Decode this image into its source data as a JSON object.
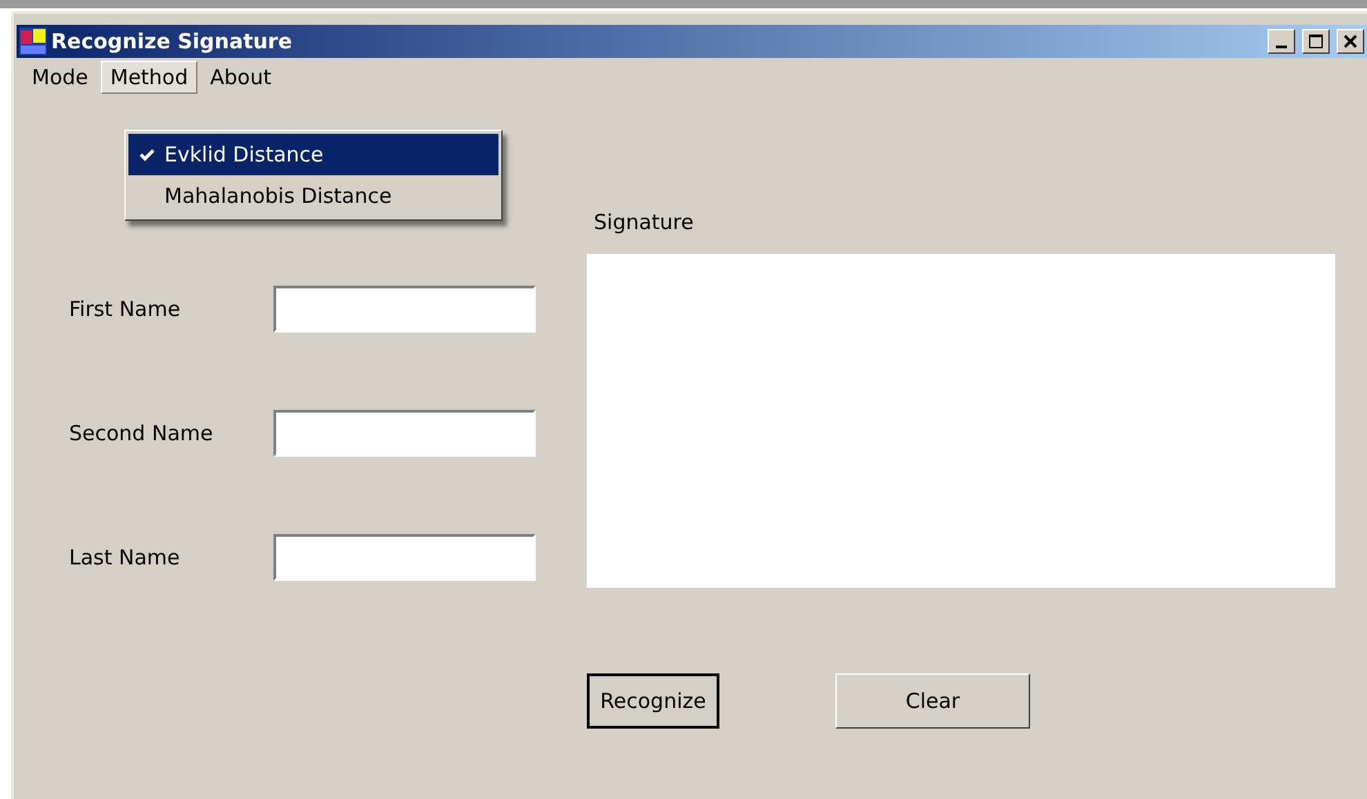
{
  "window": {
    "title": "Recognize Signature"
  },
  "menu": [
    {
      "label": "Mode",
      "selected": false
    },
    {
      "label": "Method",
      "selected": true
    },
    {
      "label": "About",
      "selected": false
    }
  ],
  "dropdown": [
    {
      "label": "Evklid Distance",
      "checked": true,
      "selected": true
    },
    {
      "label": "Mahalanobis Distance",
      "checked": false,
      "selected": false
    }
  ],
  "fields": [
    {
      "label": "First Name"
    },
    {
      "label": "Second Name"
    },
    {
      "label": "Last Name"
    }
  ],
  "signature": {
    "label": "Signature"
  },
  "buttons": [
    {
      "label": "Recognize",
      "default": true
    },
    {
      "label": "Clear",
      "default": false
    }
  ]
}
